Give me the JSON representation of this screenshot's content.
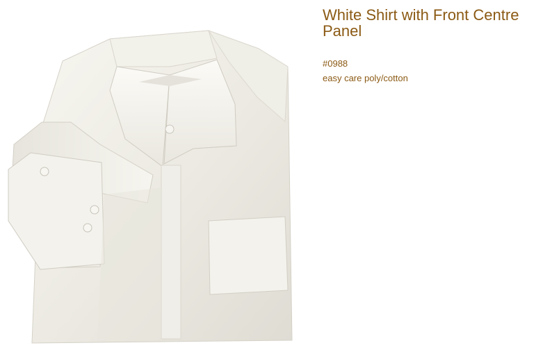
{
  "product": {
    "title": "White Shirt with Front Centre Panel",
    "code": "#0988",
    "description": "easy care poly/cotton",
    "image_alt": "white-folded-shirt"
  },
  "colors": {
    "text": "#8b5a14",
    "background": "#ffffff"
  }
}
